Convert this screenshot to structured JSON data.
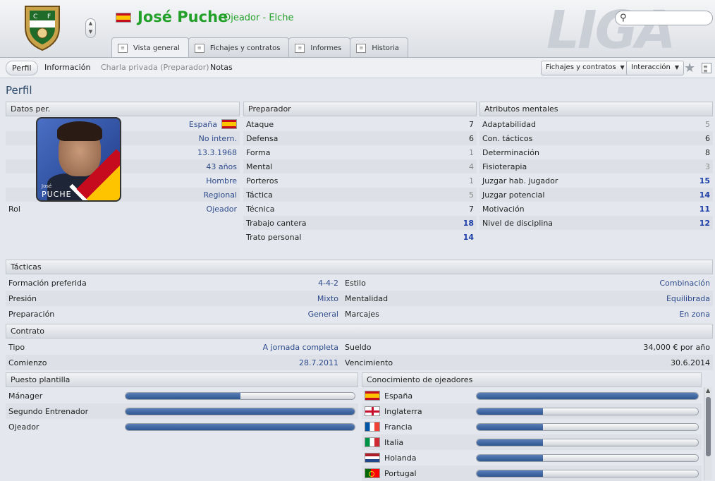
{
  "header": {
    "watermark": "LIGA a",
    "person_name": "José Puche",
    "role_club": "Ojeador - Elche",
    "tabs": [
      {
        "label": "Vista general",
        "icon": "person-card-icon"
      },
      {
        "label": "Fichajes y contratos",
        "icon": "document-icon"
      },
      {
        "label": "Informes",
        "icon": "notebook-icon"
      },
      {
        "label": "Historia",
        "icon": "scroll-icon"
      }
    ]
  },
  "subnav": {
    "items": [
      "Perfil",
      "Información",
      "Charla privada (Preparador)",
      "Notas"
    ],
    "dropdown1": "Fichajes y contratos",
    "dropdown2": "Interacción"
  },
  "page_title": "Perfil",
  "datos": {
    "header": "Datos per.",
    "photo_first": "José",
    "photo_last": "PUCHE",
    "rows": [
      {
        "label": "",
        "value": "España"
      },
      {
        "label": "",
        "value": "No intern."
      },
      {
        "label": "",
        "value": "13.3.1968"
      },
      {
        "label": "",
        "value": "43 años"
      },
      {
        "label": "",
        "value": "Hombre"
      },
      {
        "label": "",
        "value": "Regional"
      },
      {
        "label": "Rol",
        "value": "Ojeador"
      }
    ]
  },
  "preparador": {
    "header": "Preparador",
    "rows": [
      {
        "label": "Ataque",
        "value": "7"
      },
      {
        "label": "Defensa",
        "value": "6"
      },
      {
        "label": "Forma",
        "value": "1"
      },
      {
        "label": "Mental",
        "value": "4"
      },
      {
        "label": "Porteros",
        "value": "1"
      },
      {
        "label": "Táctica",
        "value": "5"
      },
      {
        "label": "Técnica",
        "value": "7"
      },
      {
        "label": "Trabajo cantera",
        "value": "18"
      },
      {
        "label": "Trato personal",
        "value": "14"
      }
    ]
  },
  "mentales": {
    "header": "Atributos mentales",
    "rows": [
      {
        "label": "Adaptabilidad",
        "value": "5"
      },
      {
        "label": "Con. tácticos",
        "value": "6"
      },
      {
        "label": "Determinación",
        "value": "8"
      },
      {
        "label": "Fisioterapia",
        "value": "3"
      },
      {
        "label": "Juzgar hab. jugador",
        "value": "15"
      },
      {
        "label": "Juzgar potencial",
        "value": "14"
      },
      {
        "label": "Motivación",
        "value": "11"
      },
      {
        "label": "Nivel de disciplina",
        "value": "12"
      }
    ]
  },
  "tacticas": {
    "header": "Tácticas",
    "rows": [
      {
        "l1": "Formación preferida",
        "v1": "4-4-2",
        "l2": "Estilo",
        "v2": "Combinación"
      },
      {
        "l1": "Presión",
        "v1": "Mixto",
        "l2": "Mentalidad",
        "v2": "Equilibrada"
      },
      {
        "l1": "Preparación",
        "v1": "General",
        "l2": "Marcajes",
        "v2": "En zona"
      }
    ]
  },
  "contrato": {
    "header": "Contrato",
    "rows": [
      {
        "l1": "Tipo",
        "v1": "A jornada completa",
        "l2": "Sueldo",
        "v2": "34,000 € por año"
      },
      {
        "l1": "Comienzo",
        "v1": "28.7.2011",
        "l2": "Vencimiento",
        "v2": "30.6.2014"
      }
    ]
  },
  "puesto": {
    "header": "Puesto plantilla",
    "rows": [
      {
        "label": "Mánager",
        "level": 0.5
      },
      {
        "label": "Segundo Entrenador",
        "level": 1.0
      },
      {
        "label": "Ojeador",
        "level": 1.0
      }
    ]
  },
  "conocimiento": {
    "header": "Conocimiento de ojeadores",
    "rows": [
      {
        "label": "España",
        "flag": "es",
        "level": 1.0
      },
      {
        "label": "Inglaterra",
        "flag": "en",
        "level": 0.3
      },
      {
        "label": "Francia",
        "flag": "fr",
        "level": 0.3
      },
      {
        "label": "Italia",
        "flag": "it",
        "level": 0.3
      },
      {
        "label": "Holanda",
        "flag": "nl",
        "level": 0.3
      },
      {
        "label": "Portugal",
        "flag": "pt",
        "level": 0.3
      }
    ]
  },
  "colors": {
    "name_green": "#23a02a",
    "bar_blue": "#2f578f",
    "high_value": "#1f3fa8"
  }
}
